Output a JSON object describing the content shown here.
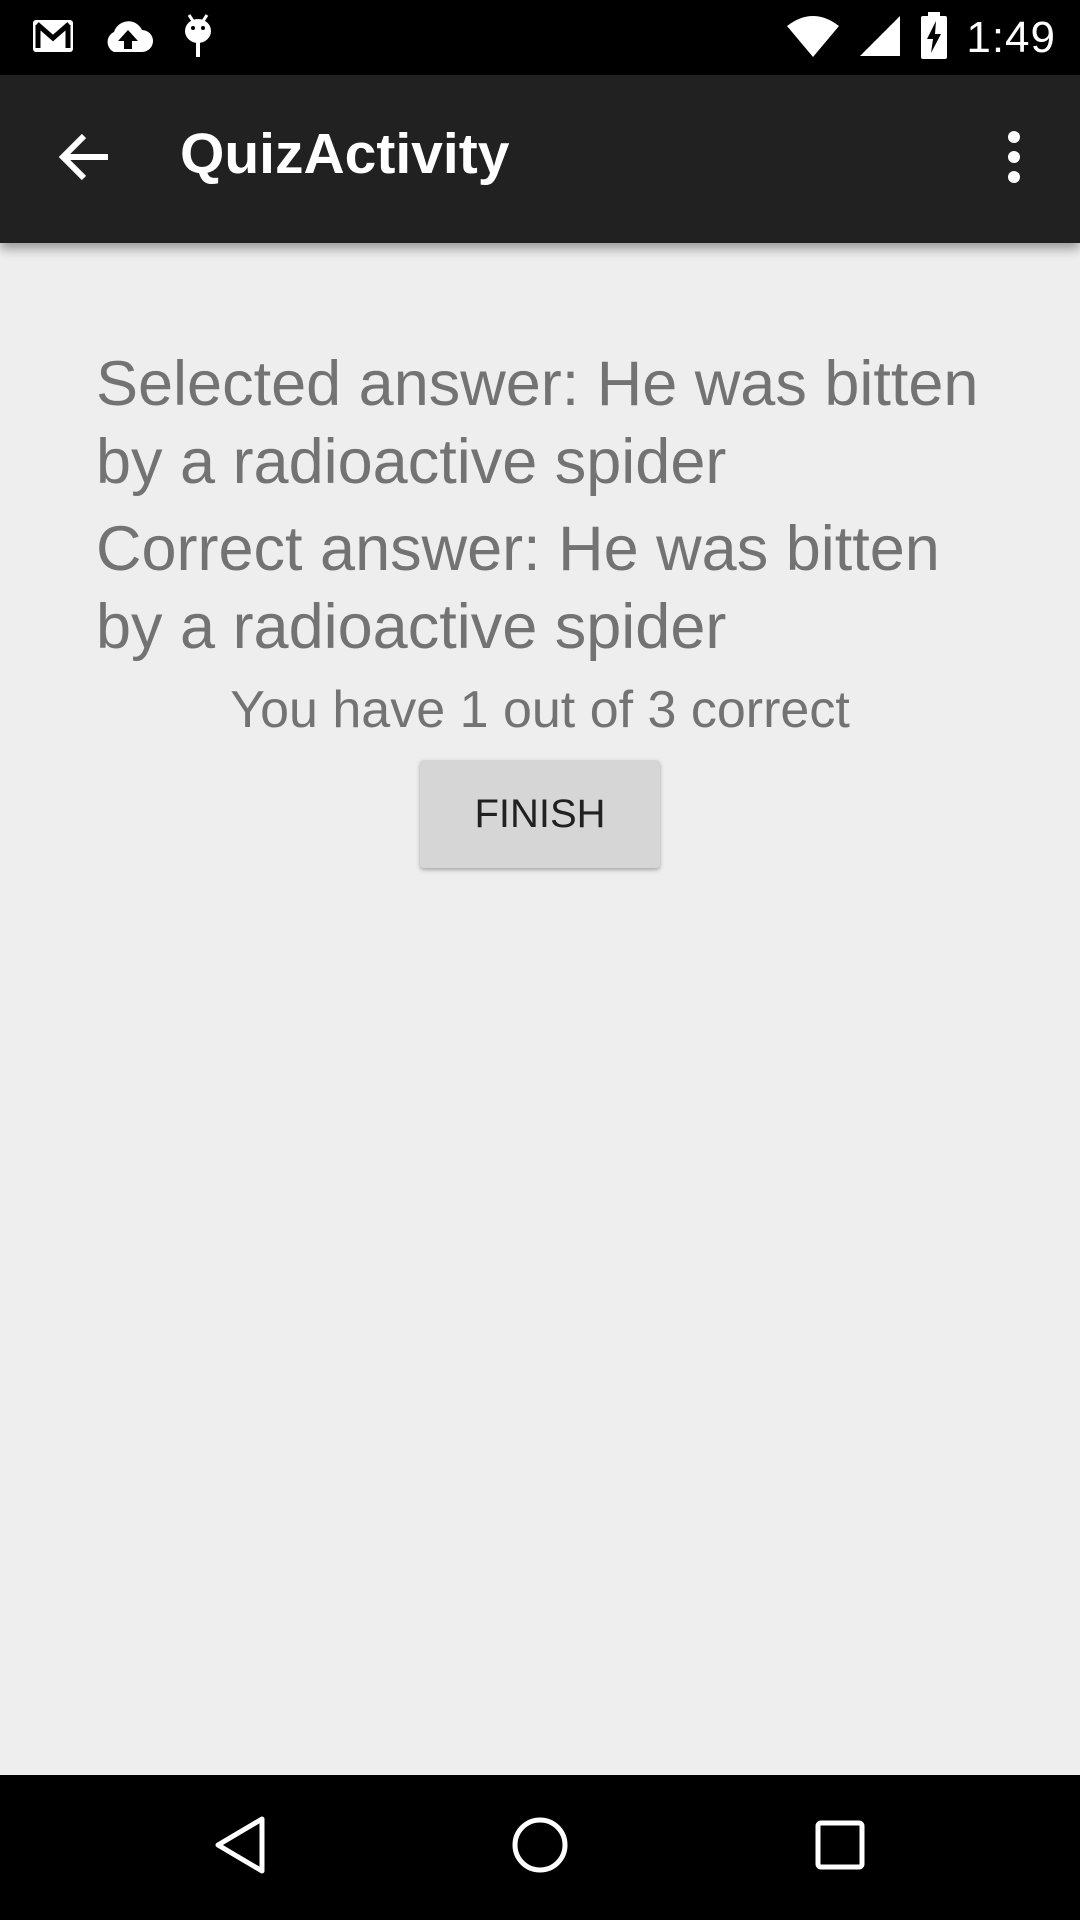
{
  "status_bar": {
    "time": "1:49",
    "left_icons": [
      "gmail-icon",
      "cloud-upload-icon",
      "android-debug-icon"
    ],
    "right_icons": [
      "wifi-icon",
      "cell-signal-icon",
      "battery-charging-icon"
    ]
  },
  "app_bar": {
    "title": "QuizActivity",
    "back_icon": "arrow-back-icon",
    "overflow_icon": "more-vert-icon"
  },
  "content": {
    "selected_answer": "Selected answer: He was bitten by a radioactive spider",
    "correct_answer": "Correct answer: He was bitten by a radioactive spider",
    "score": "You have 1 out of 3 correct",
    "finish_label": "FINISH"
  },
  "nav_bar": {
    "back_icon": "nav-back-icon",
    "home_icon": "nav-home-icon",
    "recents_icon": "nav-recents-icon"
  },
  "colors": {
    "status_bar": "#000000",
    "app_bar": "#212121",
    "background": "#eeeeee",
    "body_text": "#737373",
    "button_bg": "#d6d6d6"
  }
}
